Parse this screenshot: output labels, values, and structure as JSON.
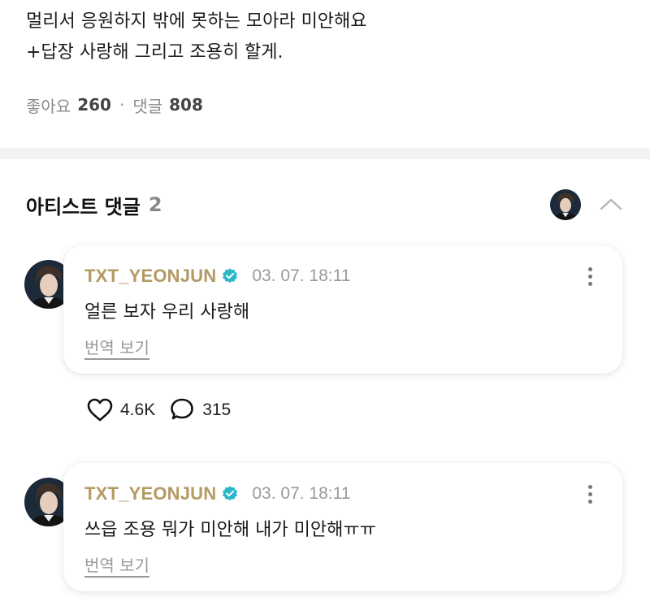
{
  "post": {
    "text_line1": "멀리서 응원하지 밖에 못하는 모아라 미안해요",
    "text_line2": "+답장 사랑해 그리고 조용히 할게.",
    "likes_label": "좋아요",
    "likes_count": "260",
    "separator": "·",
    "comments_label": "댓글",
    "comments_count": "808"
  },
  "artist_comments": {
    "title": "아티스트 댓글",
    "count": "2"
  },
  "comments": [
    {
      "author": "TXT_YEONJUN",
      "timestamp": "03. 07. 18:11",
      "text": "얼른 보자 우리 사랑해",
      "translate_label": "번역 보기",
      "likes": "4.6K",
      "replies": "315"
    },
    {
      "author": "TXT_YEONJUN",
      "timestamp": "03. 07. 18:11",
      "text": "쓰읍 조용 뭐가 미안해 내가 미안해ㅠㅠ",
      "translate_label": "번역 보기"
    }
  ],
  "icons": {
    "verified": "verified-badge-icon",
    "more": "more-vertical-icon",
    "collapse": "chevron-up-icon",
    "like": "heart-icon",
    "reply": "speech-bubble-icon"
  },
  "colors": {
    "author": "#b39a63",
    "verified": "#2bb7c7",
    "muted": "#9a9a9a",
    "divider": "#f3f3f3"
  }
}
